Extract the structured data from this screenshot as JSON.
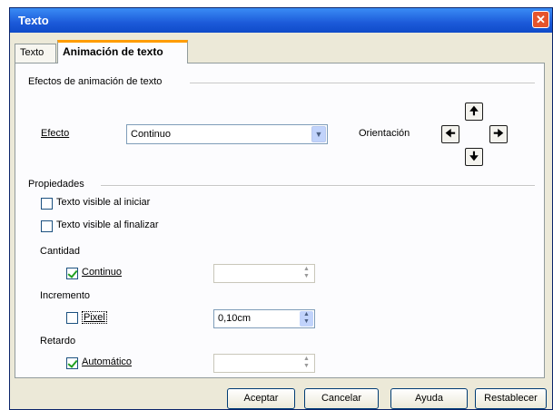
{
  "window": {
    "title": "Texto",
    "close_glyph": "✕"
  },
  "tabs": [
    {
      "label": "Texto"
    },
    {
      "label": "Animación de texto"
    }
  ],
  "anim_section": {
    "title": "Efectos de animación de texto",
    "effect_label": "Efecto",
    "effect_value": "Continuo",
    "orientation_label": "Orientación",
    "arrows": {
      "up": "🠉",
      "left": "🠈",
      "right": "🠊",
      "down": "🠋"
    }
  },
  "props_section": {
    "title": "Propiedades",
    "visible_start_label": "Texto visible al iniciar",
    "visible_start_checked": false,
    "visible_end_label": "Texto visible al finalizar",
    "visible_end_checked": false,
    "cantidad_label": "Cantidad",
    "continuo_label": "Continuo",
    "continuo_checked": true,
    "cantidad_value": "",
    "incremento_label": "Incremento",
    "pixel_label": "Pixel",
    "pixel_checked": false,
    "incremento_value": "0,10cm",
    "retardo_label": "Retardo",
    "automatico_label": "Automático",
    "automatico_checked": true,
    "retardo_value": ""
  },
  "buttons": {
    "accept": "Aceptar",
    "cancel": "Cancelar",
    "help": "Ayuda",
    "reset": "Restablecer"
  }
}
